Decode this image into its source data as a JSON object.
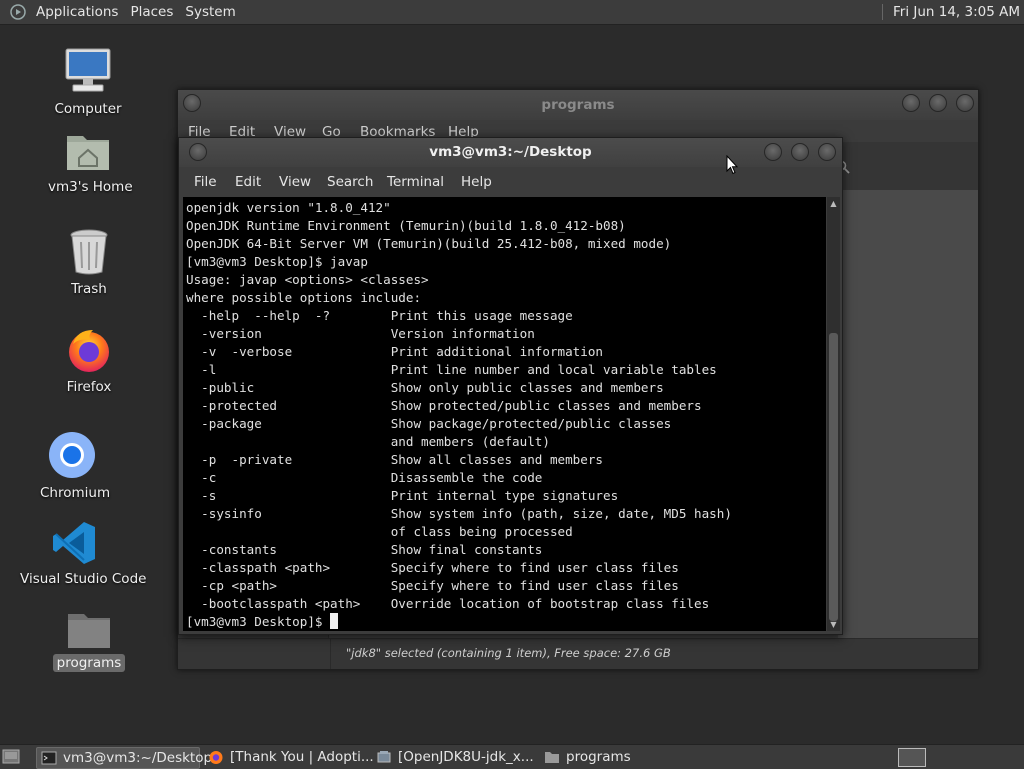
{
  "top_panel": {
    "menus": [
      "Applications",
      "Places",
      "System"
    ],
    "clock": "Fri Jun 14,  3:05 AM"
  },
  "desktop_icons": [
    {
      "label": "Computer",
      "icon": "computer-icon"
    },
    {
      "label": "vm3's Home",
      "icon": "home-folder-icon"
    },
    {
      "label": "Trash",
      "icon": "trash-icon"
    },
    {
      "label": "Firefox",
      "icon": "firefox-icon"
    },
    {
      "label": "Chromium",
      "icon": "chromium-icon"
    },
    {
      "label": "Visual Studio Code",
      "icon": "vscode-icon"
    },
    {
      "label": "programs",
      "icon": "folder-icon",
      "selected": true
    }
  ],
  "file_manager": {
    "title": "programs",
    "menu": [
      "File",
      "Edit",
      "View",
      "Go",
      "Bookmarks",
      "Help"
    ],
    "status": "\"jdk8\" selected (containing 1 item), Free space: 27.6 GB"
  },
  "terminal": {
    "title": "vm3@vm3:~/Desktop",
    "menu": [
      "File",
      "Edit",
      "View",
      "Search",
      "Terminal",
      "Help"
    ],
    "lines": [
      "openjdk version \"1.8.0_412\"",
      "OpenJDK Runtime Environment (Temurin)(build 1.8.0_412-b08)",
      "OpenJDK 64-Bit Server VM (Temurin)(build 25.412-b08, mixed mode)",
      "[vm3@vm3 Desktop]$ javap",
      "Usage: javap <options> <classes>",
      "where possible options include:",
      "  -help  --help  -?        Print this usage message",
      "  -version                 Version information",
      "  -v  -verbose             Print additional information",
      "  -l                       Print line number and local variable tables",
      "  -public                  Show only public classes and members",
      "  -protected               Show protected/public classes and members",
      "  -package                 Show package/protected/public classes",
      "                           and members (default)",
      "  -p  -private             Show all classes and members",
      "  -c                       Disassemble the code",
      "  -s                       Print internal type signatures",
      "  -sysinfo                 Show system info (path, size, date, MD5 hash)",
      "                           of class being processed",
      "  -constants               Show final constants",
      "  -classpath <path>        Specify where to find user class files",
      "  -cp <path>               Specify where to find user class files",
      "  -bootclasspath <path>    Override location of bootstrap class files"
    ],
    "prompt": "[vm3@vm3 Desktop]$ "
  },
  "taskbar": {
    "tasks": [
      {
        "label": "vm3@vm3:~/Desktop",
        "icon": "terminal-icon",
        "active": true
      },
      {
        "label": "[Thank You | Adopti...",
        "icon": "firefox-icon",
        "active": false
      },
      {
        "label": "[OpenJDK8U-jdk_x...",
        "icon": "archive-icon",
        "active": false
      },
      {
        "label": "programs",
        "icon": "folder-icon",
        "active": false
      }
    ]
  }
}
